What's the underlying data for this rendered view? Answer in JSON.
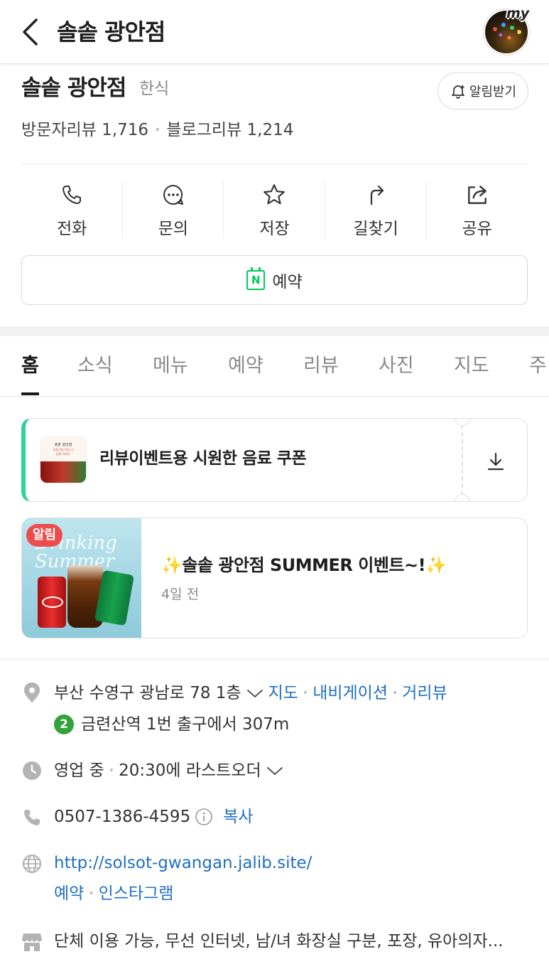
{
  "topbar": {
    "title": "솔솥 광안점",
    "profile_badge": "my"
  },
  "place": {
    "name": "솔솥 광안점",
    "category": "한식",
    "alarm_label": "알림받기",
    "visitor_review_label": "방문자리뷰",
    "visitor_review_count": "1,716",
    "blog_review_label": "블로그리뷰",
    "blog_review_count": "1,214"
  },
  "actions": [
    {
      "label": "전화",
      "icon": "phone-icon"
    },
    {
      "label": "문의",
      "icon": "chat-icon"
    },
    {
      "label": "저장",
      "icon": "star-icon"
    },
    {
      "label": "길찾기",
      "icon": "directions-icon"
    },
    {
      "label": "공유",
      "icon": "share-icon"
    }
  ],
  "reserve": {
    "label": "예약",
    "icon_letter": "N"
  },
  "tabs": [
    "홈",
    "소식",
    "메뉴",
    "예약",
    "리뷰",
    "사진",
    "지도",
    "주"
  ],
  "coupon": {
    "title": "리뷰이벤트용 시원한 음료 쿠폰",
    "thumb_text_1": "솔솥 광안점",
    "thumb_text_2": "포토리뷰 작성 시",
    "thumb_text_3": "음료 서비스"
  },
  "news": {
    "badge": "알림",
    "image_script": "Drinking Summer",
    "title": "✨솔솥 광안점 SUMMER 이벤트~!✨",
    "time": "4일 전"
  },
  "info": {
    "address": "부산 수영구 광남로 78 1층",
    "address_links": [
      "지도",
      "내비게이션",
      "거리뷰"
    ],
    "subway_line": "2",
    "subway_text": "금련산역 1번 출구에서 307m",
    "hours_status": "영업 중",
    "hours_detail": "20:30에 라스트오더",
    "phone": "0507-1386-4595",
    "phone_copy": "복사",
    "website": "http://solsot-gwangan.jalib.site/",
    "website_links": [
      "예약",
      "인스타그램"
    ],
    "amenities": "단체 이용 가능, 무선 인터넷, 남/녀 화장실 구분, 포장, 유아의자..."
  },
  "colors": {
    "accent_green": "#03c75a",
    "coupon_accent": "#2ed39a",
    "link_blue": "#1f6fc5",
    "badge_red": "#ee4b4b",
    "subway_line2": "#33a23d"
  }
}
